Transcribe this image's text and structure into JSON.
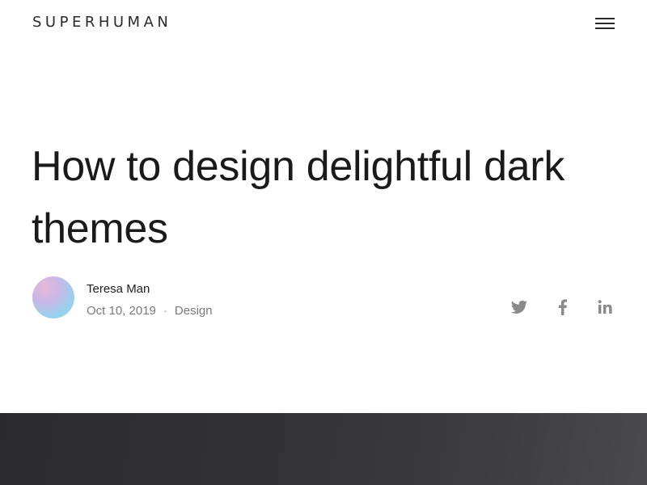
{
  "header": {
    "logo": "SUPERHUMAN",
    "menu_icon": "hamburger-menu-icon"
  },
  "article": {
    "title": "How to design delightful dark themes",
    "author": "Teresa Man",
    "date": "Oct 10, 2019",
    "separator": "·",
    "category": "Design"
  },
  "share": {
    "icons": [
      "twitter-icon",
      "facebook-icon",
      "linkedin-icon"
    ]
  },
  "colors": {
    "text": "#1a1a1a",
    "muted": "#7a7a7a",
    "icon": "#8a8a8a",
    "hero_dark": "#2b2b2d",
    "avatar_pink": "#e9b9d8",
    "avatar_blue": "#8fd6f2"
  }
}
